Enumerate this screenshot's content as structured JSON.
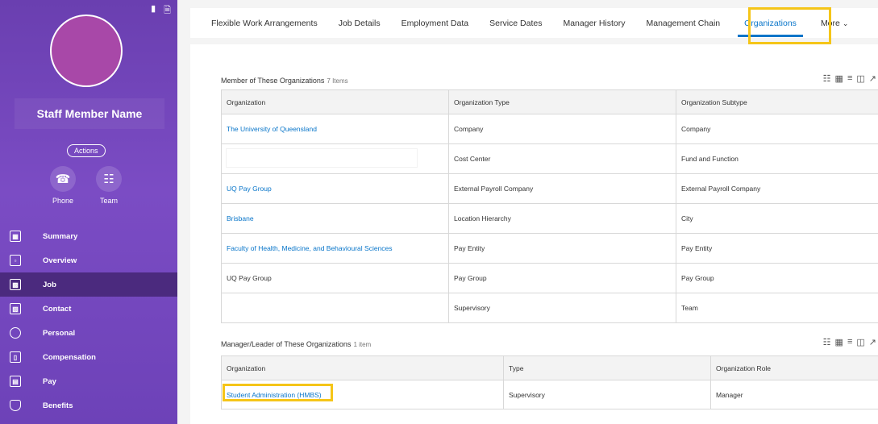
{
  "profile": {
    "name": "Staff Member Name",
    "actions_label": "Actions",
    "quick_actions": [
      {
        "label": "Phone",
        "icon": "phone-icon"
      },
      {
        "label": "Team",
        "icon": "team-icon"
      }
    ]
  },
  "nav": {
    "items": [
      {
        "label": "Summary",
        "icon": "grid-icon"
      },
      {
        "label": "Overview",
        "icon": "overview-icon"
      },
      {
        "label": "Job",
        "icon": "briefcase-icon",
        "active": true
      },
      {
        "label": "Contact",
        "icon": "contact-icon"
      },
      {
        "label": "Personal",
        "icon": "person-icon"
      },
      {
        "label": "Compensation",
        "icon": "chart-icon"
      },
      {
        "label": "Pay",
        "icon": "wallet-icon"
      },
      {
        "label": "Benefits",
        "icon": "shield-icon"
      }
    ]
  },
  "tabs": [
    {
      "label": "Flexible Work Arrangements"
    },
    {
      "label": "Job Details"
    },
    {
      "label": "Employment Data"
    },
    {
      "label": "Service Dates"
    },
    {
      "label": "Manager History"
    },
    {
      "label": "Management Chain"
    },
    {
      "label": "Organizations",
      "active": true
    },
    {
      "label": "More"
    }
  ],
  "member_section": {
    "title": "Member of These Organizations",
    "count": "7 Items",
    "columns": [
      "Organization",
      "Organization Type",
      "Organization Subtype"
    ],
    "rows": [
      [
        "The University of Queensland",
        "Company",
        "Company"
      ],
      [
        "",
        "Cost Center",
        "Fund and Function"
      ],
      [
        "UQ Pay Group",
        "External Payroll Company",
        "External Payroll Company"
      ],
      [
        "Brisbane",
        "Location Hierarchy",
        "City"
      ],
      [
        "Faculty of Health, Medicine, and Behavioural Sciences",
        "Pay Entity",
        "Pay Entity"
      ],
      [
        "UQ Pay Group",
        "Pay Group",
        "Pay Group"
      ],
      [
        "",
        "Supervisory",
        "Team"
      ]
    ]
  },
  "manager_section": {
    "title": "Manager/Leader of These Organizations",
    "count": "1 item",
    "columns": [
      "Organization",
      "Type",
      "Organization Role"
    ],
    "rows": [
      [
        "Student Administration (HMBS)",
        "Supervisory",
        "Manager"
      ]
    ]
  },
  "colors": {
    "accent": "#0875c9",
    "highlight": "#f5c518",
    "sidebar": "#6a3fb0"
  }
}
